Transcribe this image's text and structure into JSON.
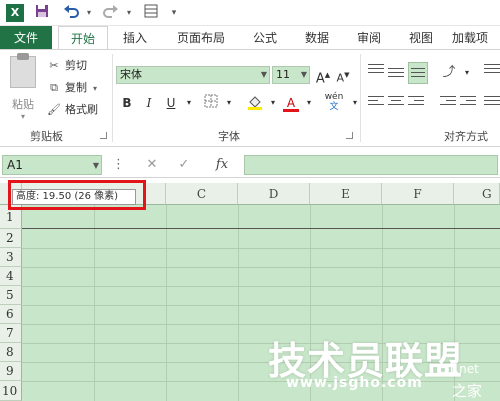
{
  "qat": {
    "app_icon": "X",
    "icons": [
      "save-icon",
      "undo-icon",
      "redo-icon",
      "form-icon",
      "customize-qat-icon"
    ]
  },
  "tabs": {
    "file": "文件",
    "items": [
      "开始",
      "插入",
      "页面布局",
      "公式",
      "数据",
      "审阅",
      "视图",
      "加载项"
    ],
    "active": "开始"
  },
  "ribbon": {
    "clipboard": {
      "paste": "粘贴",
      "cut": "剪切",
      "copy": "复制",
      "format_painter": "格式刷",
      "group_label": "剪贴板"
    },
    "font": {
      "font_name": "宋体",
      "font_size": "11",
      "bold": "B",
      "italic": "I",
      "underline": "U",
      "font_color_letter": "A",
      "phonetic": "wén",
      "group_label": "字体"
    },
    "alignment": {
      "group_label": "对齐方式"
    }
  },
  "formula_bar": {
    "name_box": "A1",
    "fx": "fx"
  },
  "grid": {
    "columns": [
      "C",
      "D",
      "E",
      "F",
      "G"
    ],
    "rows": [
      "1",
      "2",
      "3",
      "4",
      "5",
      "6",
      "7",
      "8",
      "9",
      "10"
    ],
    "tooltip": "高度: 19.50 (26 像素)"
  },
  "watermark": {
    "main": "技术员联盟",
    "sub": "www.jsgho.com",
    "corner_1": "51.net",
    "corner_2": "之家"
  },
  "colors": {
    "excel_green": "#217346",
    "cell_fill": "#c8e6c9",
    "highlight_red": "#e3151a"
  }
}
